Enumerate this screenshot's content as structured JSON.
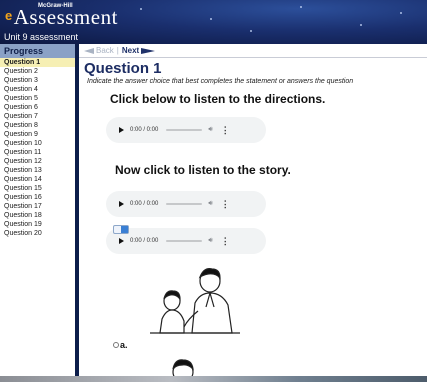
{
  "header": {
    "publisher": "McGraw-Hill",
    "brand_mark": "e",
    "brand_text": "Assessment",
    "unit_title": "Unit 9 assessment",
    "colors": {
      "header_bg": "#1a2f6e",
      "brand_mark": "#f2a41c"
    }
  },
  "toolbar": {
    "progress_label": "Progress",
    "back_label": "Back",
    "next_label": "Next",
    "back_icon": "arrow-left-icon",
    "next_icon": "arrow-right-icon"
  },
  "sidebar": {
    "items": [
      {
        "label": "Question 1",
        "active": true
      },
      {
        "label": "Question 2"
      },
      {
        "label": "Question 3"
      },
      {
        "label": "Question 4"
      },
      {
        "label": "Question 5"
      },
      {
        "label": "Question 6"
      },
      {
        "label": "Question 7"
      },
      {
        "label": "Question 8"
      },
      {
        "label": "Question 9"
      },
      {
        "label": "Question 10"
      },
      {
        "label": "Question 11"
      },
      {
        "label": "Question 12"
      },
      {
        "label": "Question 13"
      },
      {
        "label": "Question 14"
      },
      {
        "label": "Question 15"
      },
      {
        "label": "Question 16"
      },
      {
        "label": "Question 17"
      },
      {
        "label": "Question 18"
      },
      {
        "label": "Question 19"
      },
      {
        "label": "Question 20"
      }
    ]
  },
  "main": {
    "title": "Question 1",
    "instructions": "Indicate the answer choice that best completes the statement or answers the question",
    "directions_prompt": "Click below to listen to the directions.",
    "story_prompt": "Now click to listen to the story.",
    "players": [
      {
        "time": "0:00 / 0:00"
      },
      {
        "time": "0:00 / 0:00"
      },
      {
        "time": "0:00 / 0:00"
      }
    ],
    "option_a_label": "a."
  }
}
